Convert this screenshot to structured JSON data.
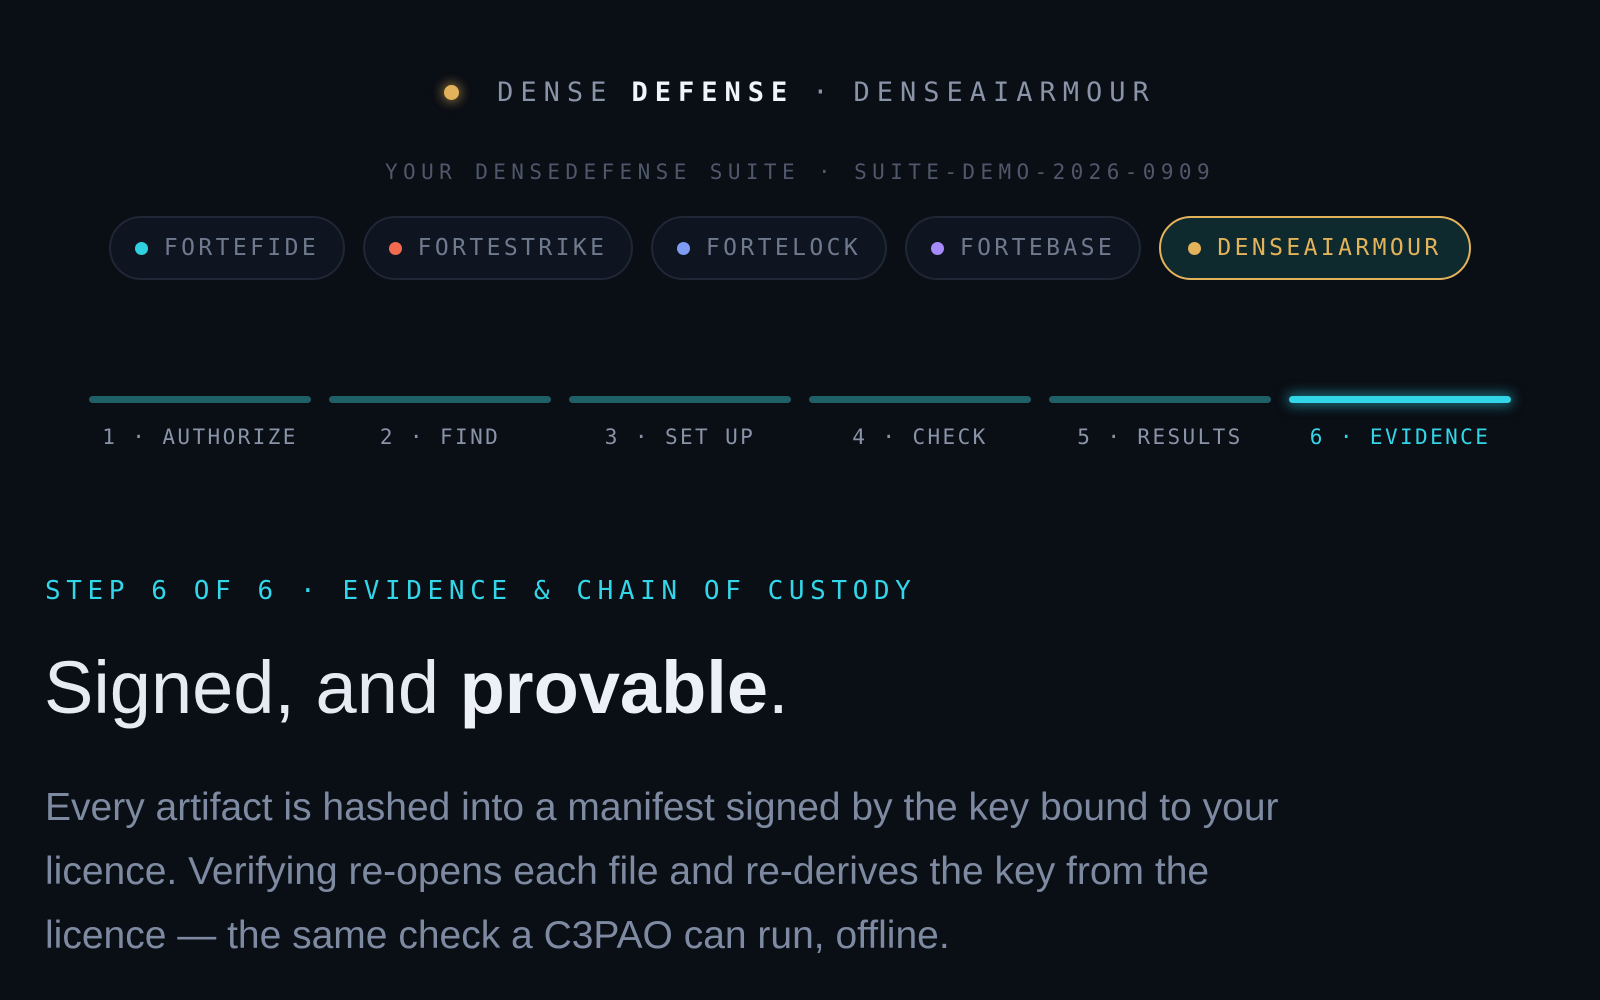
{
  "brand": {
    "part1": "DENSE",
    "part2": "DEFENSE",
    "separator": "·",
    "product": "DENSEAIARMOUR",
    "dot_color": "#e2b35a"
  },
  "suite_line": "YOUR DENSEDEFENSE SUITE · SUITE-DEMO-2026-0909",
  "products": [
    {
      "label": "FORTEFIDE",
      "color": "#2fd0e0",
      "active": false
    },
    {
      "label": "FORTESTRIKE",
      "color": "#f26b4f",
      "active": false
    },
    {
      "label": "FORTELOCK",
      "color": "#7f9cf5",
      "active": false
    },
    {
      "label": "FORTEBASE",
      "color": "#a78bfa",
      "active": false
    },
    {
      "label": "DENSEAIARMOUR",
      "color": "#e2b35a",
      "active": true
    }
  ],
  "steps": [
    {
      "label": "1 · AUTHORIZE",
      "active": false
    },
    {
      "label": "2 · FIND",
      "active": false
    },
    {
      "label": "3 · SET UP",
      "active": false
    },
    {
      "label": "4 · CHECK",
      "active": false
    },
    {
      "label": "5 · RESULTS",
      "active": false
    },
    {
      "label": "6 · EVIDENCE",
      "active": true
    }
  ],
  "main": {
    "eyebrow": "STEP 6 OF 6 · EVIDENCE & CHAIN OF CUSTODY",
    "headline_start": "Signed, and ",
    "headline_bold": "provable",
    "headline_end": ".",
    "body": "Every artifact is hashed into a manifest signed by the key bound to your licence. Verifying re-opens each file and re-derives the key from the licence — the same check a C3PAO can run, offline."
  },
  "colors": {
    "accent": "#33d6e8",
    "highlight": "#e2b35a",
    "background": "#0a0e15"
  }
}
